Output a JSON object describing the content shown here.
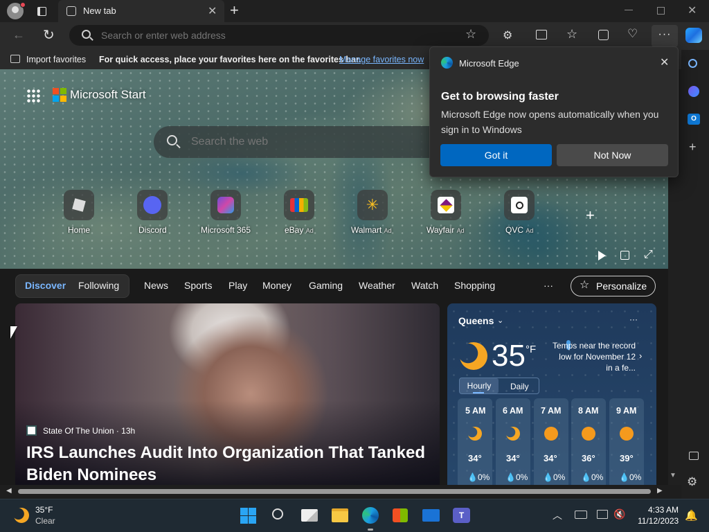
{
  "browser": {
    "tab_title": "New tab",
    "address_placeholder": "Search or enter web address"
  },
  "favorites_bar": {
    "import_label": "Import favorites",
    "hint_text": "For quick access, place your favorites here on the favorites bar.",
    "manage_link": "Manage favorites now"
  },
  "popup": {
    "app_name": "Microsoft Edge",
    "title": "Get to browsing faster",
    "body": "Microsoft Edge now opens automatically when you sign in to Windows",
    "primary_button": "Got it",
    "secondary_button": "Not Now"
  },
  "start": {
    "brand": "Microsoft Start",
    "search_placeholder": "Search the web",
    "tiles": [
      {
        "label": "Home",
        "ad": ""
      },
      {
        "label": "Discord",
        "ad": ""
      },
      {
        "label": "Microsoft 365",
        "ad": ""
      },
      {
        "label": "eBay",
        "ad": "Ad"
      },
      {
        "label": "Walmart",
        "ad": "Ad"
      },
      {
        "label": "Wayfair",
        "ad": "Ad"
      },
      {
        "label": "QVC",
        "ad": "Ad"
      }
    ]
  },
  "feed_nav": {
    "discover": "Discover",
    "following": "Following",
    "items": [
      "News",
      "Sports",
      "Play",
      "Money",
      "Gaming",
      "Weather",
      "Watch",
      "Shopping"
    ],
    "more": "···",
    "personalize": "Personalize"
  },
  "article": {
    "source": "State Of The Union · 13h",
    "headline": "IRS Launches Audit Into Organization That Tanked Biden Nominees"
  },
  "weather": {
    "location": "Queens",
    "temp": "35",
    "unit": "°F",
    "note": "Temps near the record low for November 12 in a fe...",
    "tab_hourly": "Hourly",
    "tab_daily": "Daily",
    "hours": [
      {
        "time": "5 AM",
        "temp": "34°",
        "precip": "0%"
      },
      {
        "time": "6 AM",
        "temp": "34°",
        "precip": "0%"
      },
      {
        "time": "7 AM",
        "temp": "34°",
        "precip": "0%"
      },
      {
        "time": "8 AM",
        "temp": "36°",
        "precip": "0%"
      },
      {
        "time": "9 AM",
        "temp": "39°",
        "precip": "0%"
      }
    ]
  },
  "taskbar": {
    "weather_temp": "35°F",
    "weather_desc": "Clear",
    "time": "4:33 AM",
    "date": "11/12/2023"
  },
  "colors": {
    "accent": "#0067c0",
    "link": "#7ab7ff",
    "discover": "#7ab7ff"
  }
}
